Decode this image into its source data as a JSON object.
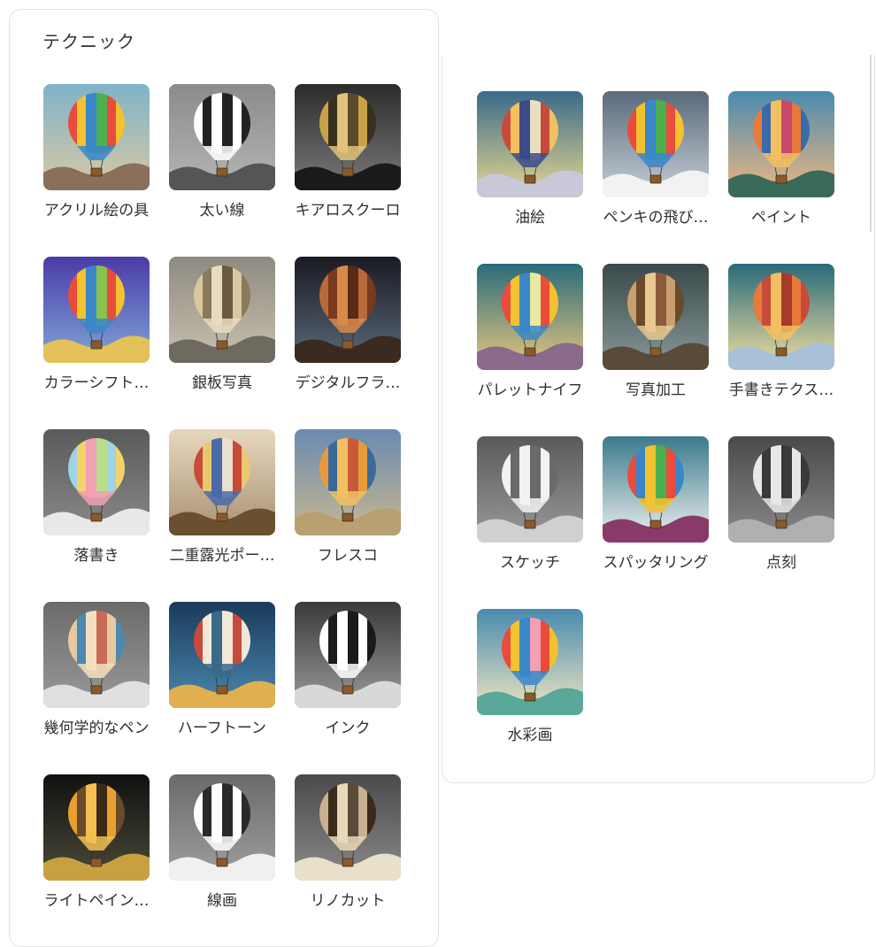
{
  "section": {
    "title": "テクニック"
  },
  "left_items": [
    {
      "label": "アクリル絵の具",
      "bg": [
        "#7fb3c9",
        "#d9c9a3"
      ],
      "ground": "#8a6f5a",
      "balloon": [
        "#e94b3c",
        "#f2c230",
        "#3a86c8",
        "#4caf50"
      ]
    },
    {
      "label": "太い線",
      "bg": [
        "#8b8b8b",
        "#b5b5b5"
      ],
      "ground": "#555555",
      "balloon": [
        "#ffffff",
        "#222222",
        "#ffffff",
        "#222222"
      ]
    },
    {
      "label": "キアロスクーロ",
      "bg": [
        "#2c2c2c",
        "#7a7a7a"
      ],
      "ground": "#1a1a1a",
      "balloon": [
        "#c9a14a",
        "#3a3020",
        "#e1c27a",
        "#5a4a2a"
      ]
    },
    {
      "label": "カラーシフト…",
      "bg": [
        "#4b3ba8",
        "#7fa6d8"
      ],
      "ground": "#e2c15a",
      "balloon": [
        "#e94b3c",
        "#f2c230",
        "#3a86c8",
        "#8bc34a"
      ]
    },
    {
      "label": "銀板写真",
      "bg": [
        "#8e8a80",
        "#c8c2b0"
      ],
      "ground": "#6e6a60",
      "balloon": [
        "#d9c7a0",
        "#8a7a5a",
        "#e8dcc0",
        "#6a5a40"
      ]
    },
    {
      "label": "デジタルフラ…",
      "bg": [
        "#1a1a22",
        "#5a6a7a"
      ],
      "ground": "#3a2a20",
      "balloon": [
        "#b86a3a",
        "#7a3a20",
        "#d88a4a",
        "#5a2a18"
      ]
    },
    {
      "label": "落書き",
      "bg": [
        "#5a5a5a",
        "#8a8a8a"
      ],
      "ground": "#e8e8e8",
      "balloon": [
        "#9ed3e8",
        "#f4d36b",
        "#f2a0b4",
        "#b8e08a"
      ]
    },
    {
      "label": "二重露光ポー…",
      "bg": [
        "#e6d8c0",
        "#a89070"
      ],
      "ground": "#6a5030",
      "balloon": [
        "#c84a3a",
        "#e8c870",
        "#4a6aa8",
        "#e8e0d0"
      ]
    },
    {
      "label": "フレスコ",
      "bg": [
        "#6a8ab0",
        "#c8b890"
      ],
      "ground": "#b8a070",
      "balloon": [
        "#e89a3a",
        "#3a6a9a",
        "#f2c060",
        "#c85a3a"
      ]
    },
    {
      "label": "幾何学的なペン",
      "bg": [
        "#6a6a6a",
        "#9a9a9a"
      ],
      "ground": "#e0e0e0",
      "balloon": [
        "#e8c8a0",
        "#4a8ab0",
        "#f2e0c0",
        "#c86a5a"
      ]
    },
    {
      "label": "ハーフトーン",
      "bg": [
        "#1a3a5a",
        "#4a8ab0"
      ],
      "ground": "#e0b050",
      "balloon": [
        "#c84a3a",
        "#f2e8d8",
        "#3a6a8a",
        "#f2e8d8"
      ]
    },
    {
      "label": "インク",
      "bg": [
        "#3a3a3a",
        "#9a9a9a"
      ],
      "ground": "#d8d8d8",
      "balloon": [
        "#ffffff",
        "#1a1a1a",
        "#ffffff",
        "#1a1a1a"
      ]
    },
    {
      "label": "ライトペイン…",
      "bg": [
        "#111111",
        "#4a4a3a"
      ],
      "ground": "#c8a040",
      "balloon": [
        "#e8a030",
        "#6a4a2a",
        "#f2c050",
        "#3a2a1a"
      ]
    },
    {
      "label": "線画",
      "bg": [
        "#6a6a6a",
        "#a0a0a0"
      ],
      "ground": "#f0f0f0",
      "balloon": [
        "#ffffff",
        "#2a2a2a",
        "#ffffff",
        "#2a2a2a"
      ]
    },
    {
      "label": "リノカット",
      "bg": [
        "#4a4a4a",
        "#8a8a8a"
      ],
      "ground": "#e8e0c8",
      "balloon": [
        "#c8b090",
        "#3a2a1a",
        "#e8d8b8",
        "#5a4a3a"
      ]
    }
  ],
  "right_items": [
    {
      "label": "油絵",
      "bg": [
        "#3a6a8a",
        "#e8d890"
      ],
      "ground": "#c8c8d8",
      "balloon": [
        "#c84a3a",
        "#f2c060",
        "#3a4a8a",
        "#e8e0c0"
      ]
    },
    {
      "label": "ペンキの飛び…",
      "bg": [
        "#5a6a7a",
        "#c8d0d8"
      ],
      "ground": "#f2f2f2",
      "balloon": [
        "#e94b3c",
        "#f2c230",
        "#3a86c8",
        "#4caf50"
      ]
    },
    {
      "label": "ペイント",
      "bg": [
        "#4a8ab0",
        "#f2b880"
      ],
      "ground": "#3a6a5a",
      "balloon": [
        "#e87a3a",
        "#3a6aa8",
        "#f2c060",
        "#c84a6a"
      ]
    },
    {
      "label": "パレットナイフ",
      "bg": [
        "#2a6a7a",
        "#e8c880"
      ],
      "ground": "#8a6a8a",
      "balloon": [
        "#e94b3c",
        "#f2c230",
        "#3a86c8",
        "#e8e8a0"
      ]
    },
    {
      "label": "写真加工",
      "bg": [
        "#3a4a4a",
        "#8a9a9a"
      ],
      "ground": "#5a4a3a",
      "balloon": [
        "#c8a070",
        "#6a4a2a",
        "#e8c890",
        "#8a5a3a"
      ]
    },
    {
      "label": "手書きテクス…",
      "bg": [
        "#2a6a7a",
        "#f2e0a0"
      ],
      "ground": "#a8c0d8",
      "balloon": [
        "#e87a3a",
        "#c84a3a",
        "#f2c060",
        "#a83a2a"
      ]
    },
    {
      "label": "スケッチ",
      "bg": [
        "#5a5a5a",
        "#9a9a9a"
      ],
      "ground": "#d0d0d0",
      "balloon": [
        "#f2f2f2",
        "#6a6a6a",
        "#f2f2f2",
        "#6a6a6a"
      ]
    },
    {
      "label": "スパッタリング",
      "bg": [
        "#3a7a8a",
        "#f2f2f2"
      ],
      "ground": "#8a3a6a",
      "balloon": [
        "#e94b3c",
        "#3a86c8",
        "#f2c230",
        "#4caf50"
      ]
    },
    {
      "label": "点刻",
      "bg": [
        "#4a4a4a",
        "#8a8a8a"
      ],
      "ground": "#b0b0b0",
      "balloon": [
        "#e8e8e8",
        "#3a3a3a",
        "#e8e8e8",
        "#3a3a3a"
      ]
    },
    {
      "label": "水彩画",
      "bg": [
        "#4a8ab0",
        "#f2e8c0"
      ],
      "ground": "#5aa89a",
      "balloon": [
        "#e94b3c",
        "#f2c230",
        "#3a86c8",
        "#f2a0b4"
      ]
    }
  ]
}
